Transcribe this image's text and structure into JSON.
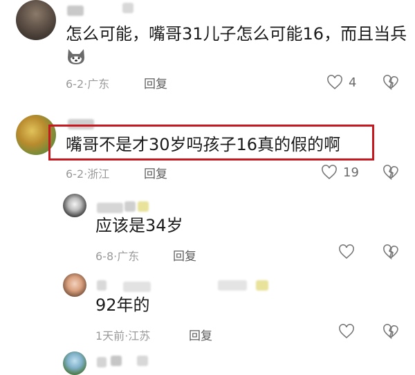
{
  "comments": [
    {
      "text": "怎么可能，嘴哥31儿子怎么可能16，而且当兵",
      "date": "6-2",
      "location": "广东",
      "reply_label": "回复",
      "likes": "4",
      "emoji": "dog-face-emoji"
    },
    {
      "text": "嘴哥不是才30岁吗孩子16真的假的啊",
      "date": "6-2",
      "location": "浙江",
      "reply_label": "回复",
      "likes": "19",
      "highlighted": true
    }
  ],
  "replies": [
    {
      "text": "应该是34岁",
      "date": "6-8",
      "location": "广东",
      "reply_label": "回复"
    },
    {
      "text": "92年的",
      "date": "1天前",
      "location": "江苏",
      "reply_label": "回复"
    }
  ],
  "colors": {
    "highlight_border": "#c8181f",
    "meta_text": "#9a9a9a"
  }
}
